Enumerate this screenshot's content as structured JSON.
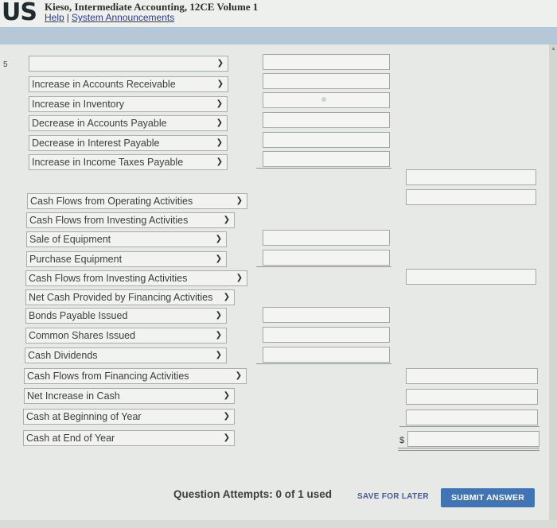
{
  "header": {
    "logo": "US",
    "title": "Kieso, Intermediate Accounting, 12CE Volume 1",
    "help_link": "Help",
    "separator": "|",
    "announcements_link": "System Announcements"
  },
  "left_mark": "5",
  "selects": [
    {
      "label": ""
    },
    {
      "label": "Increase in Accounts Receivable"
    },
    {
      "label": "Increase in Inventory"
    },
    {
      "label": "Decrease in Accounts Payable"
    },
    {
      "label": "Decrease in Interest Payable"
    },
    {
      "label": "Increase in Income Taxes Payable"
    },
    {
      "label": "Cash Flows from Operating Activities"
    },
    {
      "label": "Cash Flows from Investing Activities"
    },
    {
      "label": "Sale of Equipment"
    },
    {
      "label": "Purchase Equipment"
    },
    {
      "label": "Cash Flows from Investing Activities"
    },
    {
      "label": "Net Cash Provided by Financing Activities"
    },
    {
      "label": "Bonds Payable Issued"
    },
    {
      "label": "Common Shares Issued"
    },
    {
      "label": "Cash Dividends"
    },
    {
      "label": "Cash Flows from Financing Activities"
    },
    {
      "label": "Net Increase in Cash"
    },
    {
      "label": "Cash at Beginning of Year"
    },
    {
      "label": "Cash at End of Year"
    }
  ],
  "dollar_sign": "$",
  "footer": {
    "attempts": "Question Attempts: 0 of 1 used",
    "save_label": "SAVE FOR LATER",
    "submit_label": "SUBMIT ANSWER"
  }
}
